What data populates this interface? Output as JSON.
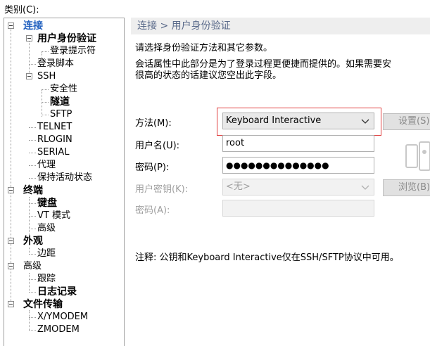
{
  "category_label": "类别(C):",
  "tree": {
    "items": [
      {
        "label": "连接"
      },
      {
        "label": "用户身份验证"
      },
      {
        "label": "登录提示符"
      },
      {
        "label": "登录脚本"
      },
      {
        "label": "SSH"
      },
      {
        "label": "安全性"
      },
      {
        "label": "隧道"
      },
      {
        "label": "SFTP"
      },
      {
        "label": "TELNET"
      },
      {
        "label": "RLOGIN"
      },
      {
        "label": "SERIAL"
      },
      {
        "label": "代理"
      },
      {
        "label": "保持活动状态"
      },
      {
        "label": "终端"
      },
      {
        "label": "键盘"
      },
      {
        "label": "VT 模式"
      },
      {
        "label": "高级"
      },
      {
        "label": "外观"
      },
      {
        "label": "边距"
      },
      {
        "label": "高级"
      },
      {
        "label": "跟踪"
      },
      {
        "label": "日志记录"
      },
      {
        "label": "文件传输"
      },
      {
        "label": "X/YMODEM"
      },
      {
        "label": "ZMODEM"
      }
    ]
  },
  "panel": {
    "breadcrumb": "连接 > 用户身份验证",
    "desc_line1": "请选择身份验证方法和其它参数。",
    "desc_line2": "会话属性中此部分是为了登录过程更便捷而提供的。如果需要安",
    "desc_line3": "很高的状态的话建议您空出此字段。"
  },
  "form": {
    "method_label": "方法(M):",
    "method_value": "Keyboard Interactive",
    "username_label": "用户名(U):",
    "username_value": "root",
    "password_label": "密码(P):",
    "password_value": "●●●●●●●●●●●●●●",
    "userkey_label": "用户密钥(K):",
    "userkey_value": "<无>",
    "passphrase_label": "密码(A):",
    "passphrase_value": ""
  },
  "buttons": {
    "setup_label": "设置(S)",
    "browse_label": "浏览(B)"
  },
  "note": "注释: 公钥和Keyboard Interactive仅在SSH/SFTP协议中可用。",
  "colors": {
    "selected_text": "#1f5fbf",
    "highlight_border": "#e04040",
    "title_bar_bg": "#eeeeee",
    "title_bar_text": "#5a6a8a"
  }
}
